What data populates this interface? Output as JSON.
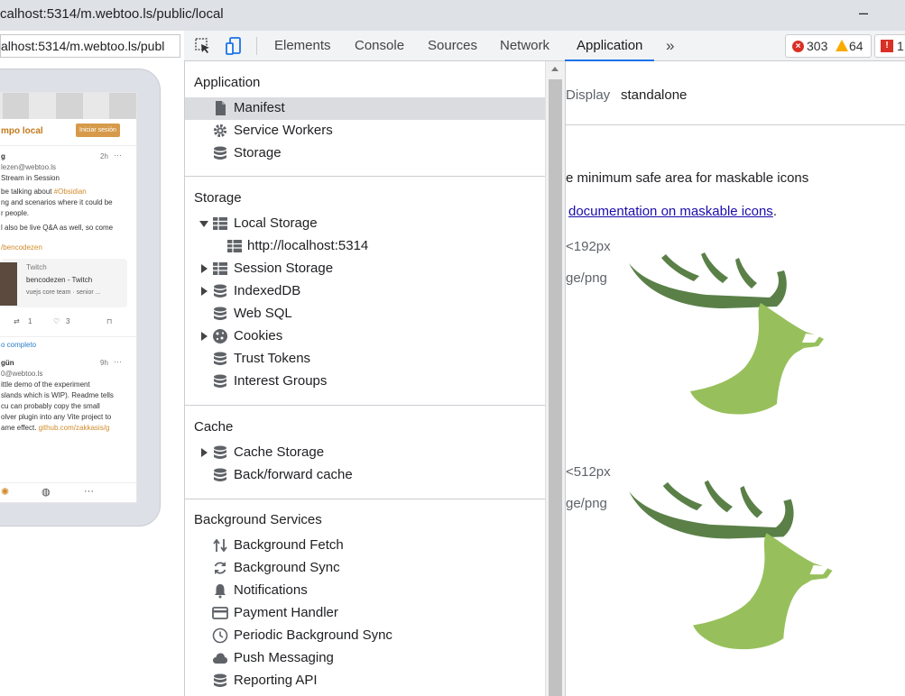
{
  "window": {
    "title": "calhost:5314/m.webtoo.ls/public/local",
    "minimize": "–"
  },
  "emulated_page": {
    "url": "alhost:5314/m.webtoo.ls/publ",
    "brand": "mpo local",
    "login_button": "Iniciar sesión",
    "post1": {
      "user": "g",
      "handle": "lezen@webtoo.ls",
      "time": "2h",
      "line1": "Stream in Session",
      "line2_pre": "be talking about ",
      "line2_tag": "#Obsidian",
      "line3": "ng and scenarios where it could be",
      "line4": "r people.",
      "line5": "l also be live Q&A as well, so come",
      "tag": "/bencodezen",
      "card_source": "Twitch",
      "card_title": "bencodezen - Twitch",
      "card_desc": "vuejs core team · senior ...",
      "reblogs": "1",
      "favs": "3"
    },
    "thread_link": "o completo",
    "post2": {
      "user": "gün",
      "handle": "0@webtoo.ls",
      "time": "9h",
      "line1": "ittle demo of the experiment",
      "line2": "slands which is WIP). Readme tells",
      "line3": "cu can probably copy the small",
      "line4": "olver plugin into any Vite project to",
      "line5_pre": "ame effect. ",
      "line5_link": "github.com/zakkasis/g"
    },
    "bottom_more": "···"
  },
  "devtools": {
    "tabs": [
      "Elements",
      "Console",
      "Sources",
      "Network",
      "Application"
    ],
    "more_tabs": "»",
    "errors": "303",
    "warnings": "64",
    "issues": "1"
  },
  "sidebar": {
    "application_title": "Application",
    "application_items": [
      "Manifest",
      "Service Workers",
      "Storage"
    ],
    "storage_title": "Storage",
    "storage_items": [
      "Local Storage",
      "http://localhost:5314",
      "Session Storage",
      "IndexedDB",
      "Web SQL",
      "Cookies",
      "Trust Tokens",
      "Interest Groups"
    ],
    "cache_title": "Cache",
    "cache_items": [
      "Cache Storage",
      "Back/forward cache"
    ],
    "bg_title": "Background Services",
    "bg_items": [
      "Background Fetch",
      "Background Sync",
      "Notifications",
      "Payment Handler",
      "Periodic Background Sync",
      "Push Messaging",
      "Reporting API"
    ]
  },
  "main": {
    "display_label": "Display",
    "display_value": "standalone",
    "maskable_text": "e minimum safe area for maskable icons",
    "doc_link": "documentation on maskable icons",
    "doc_period": ".",
    "icon1_size": "<192px",
    "icon1_type": "ge/png",
    "icon2_size": "<512px",
    "icon2_type": "ge/png"
  },
  "colors": {
    "accent": "#1a73e8",
    "deer_dark": "#5a8048",
    "deer_light": "#97c05c",
    "brand_orange": "#c47a1e"
  }
}
